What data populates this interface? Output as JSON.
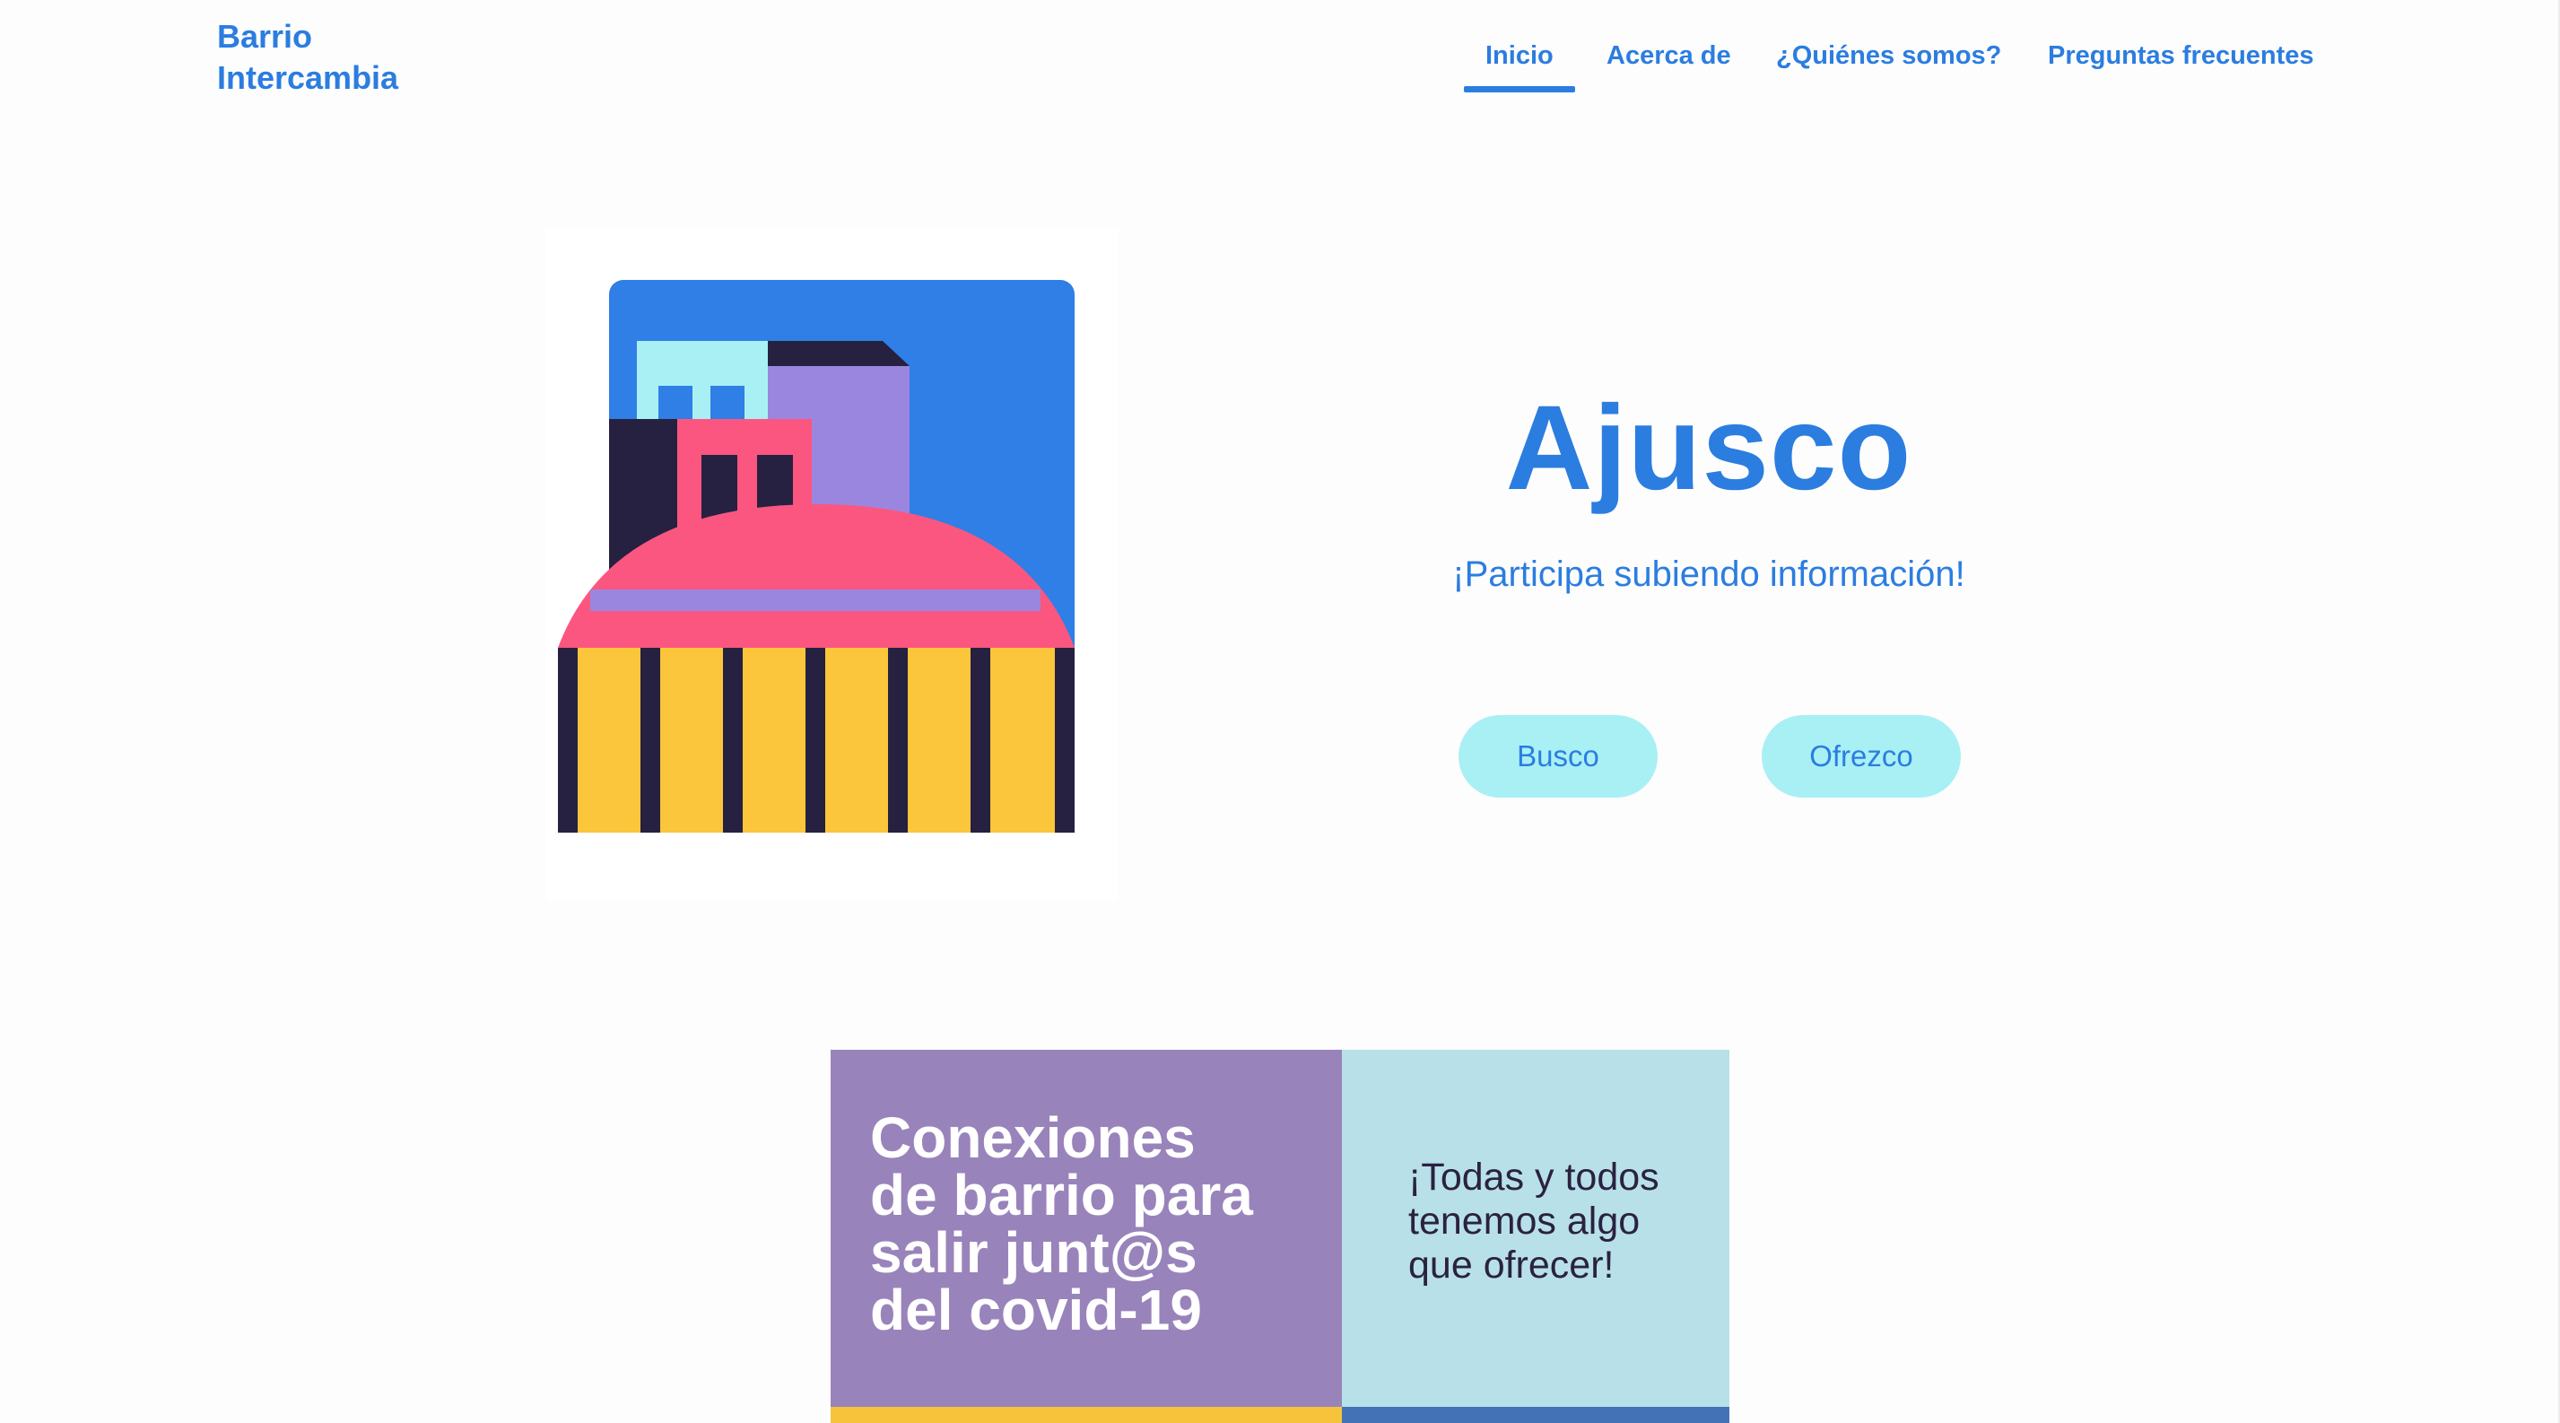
{
  "header": {
    "brand_line1": "Barrio",
    "brand_line2": "Intercambia",
    "nav": [
      {
        "label": "Inicio",
        "active": true
      },
      {
        "label": "Acerca de",
        "active": false
      },
      {
        "label": "¿Quiénes somos?",
        "active": false
      },
      {
        "label": "Preguntas frecuentes",
        "active": false
      }
    ]
  },
  "hero": {
    "title": "Ajusco",
    "subtitle": "¡Participa subiendo información!",
    "buttons": {
      "busco": "Busco",
      "ofrezco": "Ofrezco"
    },
    "illustration_icon": "neighborhood-buildings-illustration"
  },
  "banner": {
    "headline": "Conexiones\nde barrio para\nsalir junt@s\ndel covid-19",
    "tagline": "¡Todas y todos\ntenemos algo\nque ofrecer!"
  },
  "colors": {
    "accent": "#2b7de0",
    "button_bg": "#a9f0f5",
    "banner_purple": "#9983bb",
    "banner_cyan": "#b8e0e8",
    "illustration_blue": "#2f7fe6",
    "illustration_pink": "#fb5680",
    "illustration_yellow": "#fbc63b",
    "illustration_purple": "#9b86df",
    "illustration_navy": "#262140",
    "illustration_lightcyan": "#a9f0f5"
  }
}
